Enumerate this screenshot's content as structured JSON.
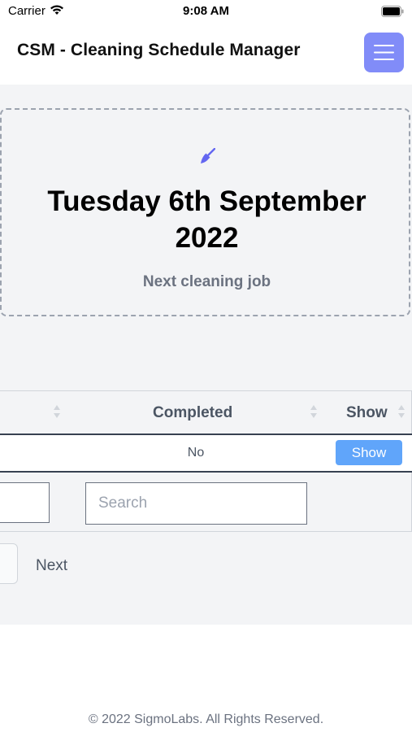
{
  "status_bar": {
    "carrier": "Carrier",
    "time": "9:08 AM"
  },
  "header": {
    "title": "CSM - Cleaning Schedule Manager",
    "menu_icon": "hamburger-menu-icon",
    "accent_color": "#818cf8"
  },
  "next_job": {
    "icon": "broom-icon",
    "date": "Tuesday 6th September 2022",
    "caption": "Next cleaning job"
  },
  "table": {
    "columns": [
      "Completed",
      "Show"
    ],
    "rows": [
      {
        "completed": "No",
        "show_label": "Show"
      }
    ],
    "search_placeholder": "Search"
  },
  "pagination": {
    "next_label": "Next"
  },
  "footer": {
    "text": "© 2022 SigmoLabs. All Rights Reserved."
  }
}
